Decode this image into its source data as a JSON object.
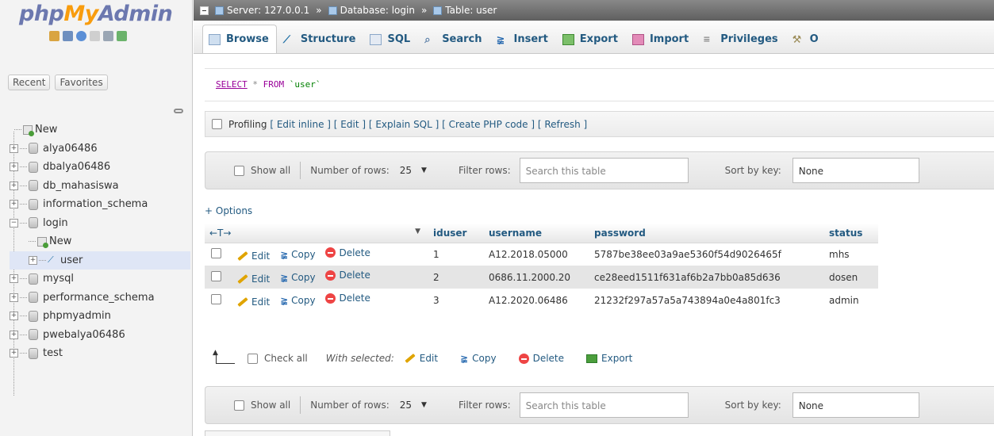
{
  "logo": {
    "part1": "php",
    "part2": "My",
    "part3": "Admin"
  },
  "left_tabs": [
    "Recent",
    "Favorites"
  ],
  "tree": {
    "new_label": "New",
    "databases": [
      "alya06486",
      "dbalya06486",
      "db_mahasiswa",
      "information_schema",
      "login"
    ],
    "login_new": "New",
    "login_table": "user",
    "databases_after": [
      "mysql",
      "performance_schema",
      "phpmyadmin",
      "pwebalya06486",
      "test"
    ]
  },
  "breadcrumb": {
    "server": "Server: 127.0.0.1",
    "database": "Database: login",
    "table": "Table: user",
    "separator": "»"
  },
  "menu_tabs": [
    "Browse",
    "Structure",
    "SQL",
    "Search",
    "Insert",
    "Export",
    "Import",
    "Privileges",
    "O"
  ],
  "sql": {
    "select": "SELECT",
    "star": "*",
    "from": "FROM",
    "table": "`user`"
  },
  "profiling": {
    "label": "Profiling",
    "links": "[ Edit inline ] [ Edit ] [ Explain SQL ] [ Create PHP code ] [ Refresh ]"
  },
  "nav": {
    "show_all": "Show all",
    "num_rows_label": "Number of rows:",
    "num_rows_value": "25",
    "filter_label": "Filter rows:",
    "search_placeholder": "Search this table",
    "sort_label": "Sort by key:",
    "sort_value": "None"
  },
  "options_link": "+ Options",
  "table": {
    "arrows": "←T→",
    "columns": [
      "iduser",
      "username",
      "password",
      "status"
    ],
    "actions": {
      "edit": "Edit",
      "copy": "Copy",
      "delete": "Delete"
    },
    "rows": [
      {
        "iduser": "1",
        "username": "A12.2018.05000",
        "password": "5787be38ee03a9ae5360f54d9026465f",
        "status": "mhs"
      },
      {
        "iduser": "2",
        "username": "0686.11.2000.20",
        "password": "ce28eed1511f631af6b2a7bb0a85d636",
        "status": "dosen"
      },
      {
        "iduser": "3",
        "username": "A12.2020.06486",
        "password": "21232f297a57a5a743894a0e4a801fc3",
        "status": "admin"
      }
    ]
  },
  "bulk": {
    "check_all": "Check all",
    "with_selected": "With selected:",
    "edit": "Edit",
    "copy": "Copy",
    "delete": "Delete",
    "export": "Export"
  },
  "colors": {
    "link": "#235a81",
    "logo_blue": "#6c78af",
    "logo_orange": "#f89c0e"
  }
}
